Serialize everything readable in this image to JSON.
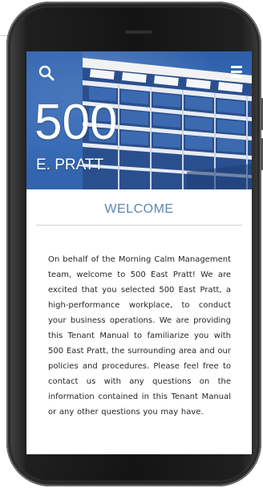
{
  "header": {
    "search_icon": "search-icon",
    "menu_icon": "hamburger-menu-icon",
    "hero_number": "500",
    "hero_subtitle": "E. PRATT"
  },
  "section": {
    "title": "WELCOME",
    "body": "On behalf of the Morning Calm Management team, welcome to 500 East Pratt! We are excited that you selected 500 East Pratt, a high-performance workplace, to conduct your business operations. We are providing this Tenant Manual to familiarize you with 500 East Pratt, the surrounding area and our policies and procedures. Please feel free to contact us with any questions on the information contained in this Tenant Manual or any other questions you may have."
  },
  "colors": {
    "accent": "#5b86b3",
    "hero_sky": "#3a6dba",
    "text": "#262626"
  }
}
